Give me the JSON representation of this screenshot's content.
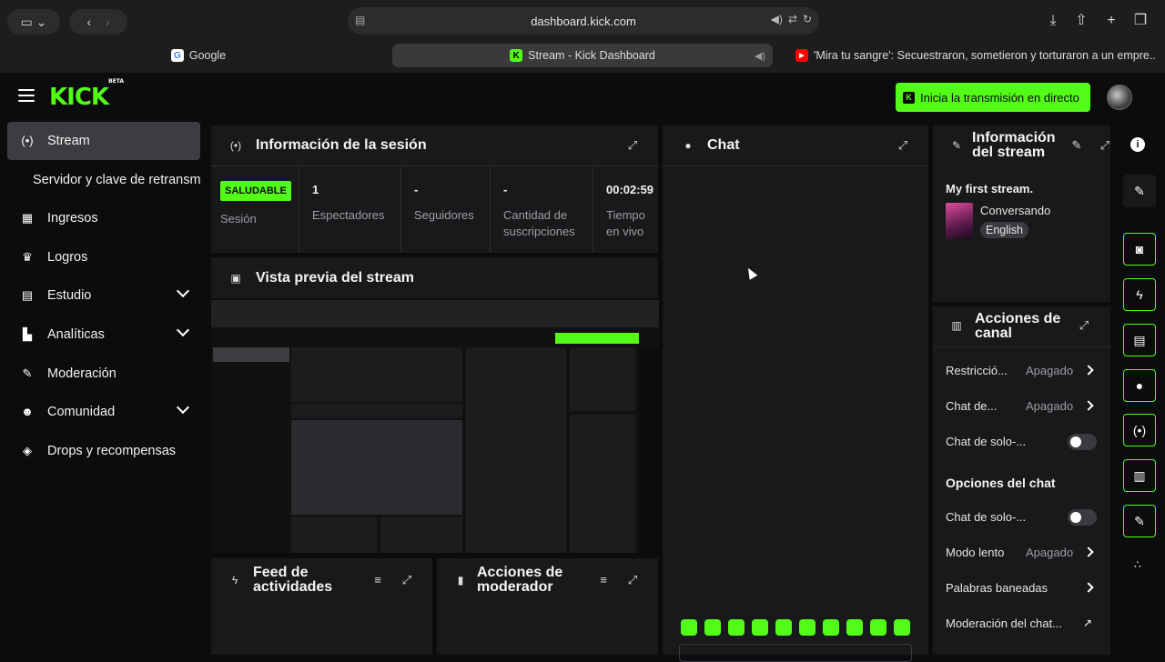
{
  "browser": {
    "url": "dashboard.kick.com",
    "tabs": [
      {
        "label": "Google"
      },
      {
        "label": "Stream - Kick Dashboard"
      },
      {
        "label": "'Mira tu sangre': Secuestraron, sometieron y torturaron a un empre..."
      }
    ]
  },
  "app": {
    "logo": "KICK",
    "logo_badge": "BETA",
    "go_live": "Inicia la transmisión en directo"
  },
  "sidebar": {
    "items": [
      {
        "label": "Stream"
      },
      {
        "label": "Servidor y clave de retransmisión"
      },
      {
        "label": "Ingresos"
      },
      {
        "label": "Logros"
      },
      {
        "label": "Estudio"
      },
      {
        "label": "Analíticas"
      },
      {
        "label": "Moderación"
      },
      {
        "label": "Comunidad"
      },
      {
        "label": "Drops y recompensas"
      }
    ]
  },
  "session": {
    "title": "Información de la sesión",
    "status": "SALUDABLE",
    "status_label": "Sesión",
    "viewers": "1",
    "viewers_label": "Espectadores",
    "followers": "-",
    "followers_label": "Seguidores",
    "subs": "-",
    "subs_label_1": "Cantidad de",
    "subs_label_2": "suscripciones",
    "time": "00:02:59",
    "time_label_1": "Tiempo",
    "time_label_2": "en vivo"
  },
  "preview": {
    "title": "Vista previa del stream"
  },
  "feed": {
    "title_1": "Feed de",
    "title_2": "actividades"
  },
  "modactions": {
    "title_1": "Acciones de",
    "title_2": "moderador"
  },
  "chat": {
    "title": "Chat"
  },
  "streaminfo": {
    "title_1": "Información",
    "title_2": "del stream",
    "stream_title": "My first stream.",
    "category": "Conversando",
    "language": "English"
  },
  "channel": {
    "title_1": "Acciones de",
    "title_2": "canal",
    "rows": [
      {
        "label": "Restricció...",
        "value": "Apagado"
      },
      {
        "label": "Chat de...",
        "value": "Apagado"
      },
      {
        "label": "Chat de solo-...",
        "value": ""
      }
    ],
    "chat_options_title": "Opciones del chat",
    "chat_rows": [
      {
        "label": "Chat de solo-...",
        "value": ""
      },
      {
        "label": "Modo lento",
        "value": "Apagado"
      },
      {
        "label": "Palabras baneadas",
        "value": ""
      },
      {
        "label": "Moderación del chat...",
        "value": ""
      }
    ]
  },
  "colors": {
    "accent": "#53fc18",
    "panel": "#18191b",
    "bg": "#0b0c0d"
  }
}
